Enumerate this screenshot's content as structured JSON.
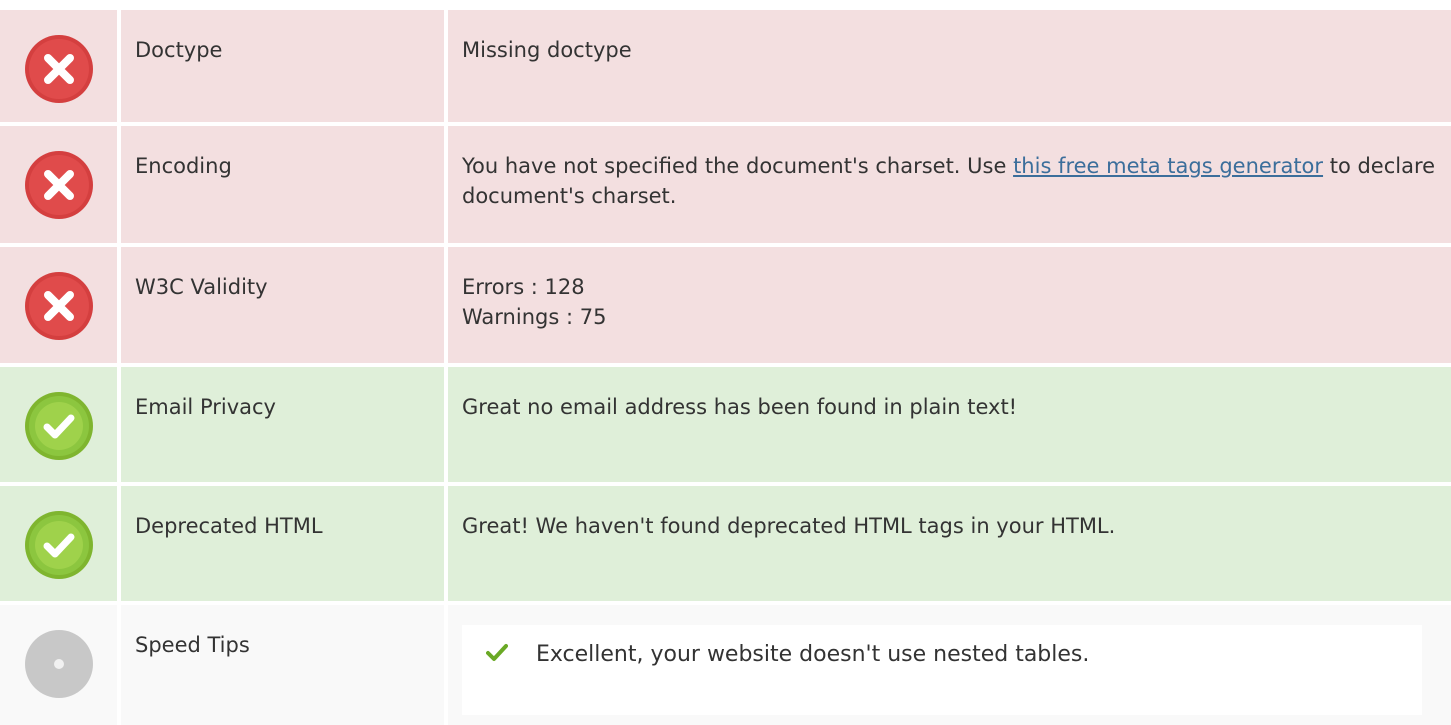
{
  "colors": {
    "error_bg": "#f3dfe0",
    "ok_bg": "#dfefd9",
    "neutral_bg": "#f9f9f9",
    "link": "#3b6e9b",
    "error_icon": "#d43f3f",
    "ok_icon": "#8cc63f"
  },
  "rows": [
    {
      "status": "error",
      "icon": "error-x-icon",
      "label": "Doctype",
      "value": "Missing doctype"
    },
    {
      "status": "error",
      "icon": "error-x-icon",
      "label": "Encoding",
      "value_before": "You have not specified the document's charset. Use ",
      "link_text": "this free meta tags generator",
      "value_after": " to declare document's charset."
    },
    {
      "status": "error",
      "icon": "error-x-icon",
      "label": "W3C Validity",
      "errors_line": "Errors : 128",
      "warnings_line": "Warnings : 75"
    },
    {
      "status": "ok",
      "icon": "check-circle-icon",
      "label": "Email Privacy",
      "value": "Great no email address has been found in plain text!"
    },
    {
      "status": "ok",
      "icon": "check-circle-icon",
      "label": "Deprecated HTML",
      "value": "Great! We haven't found deprecated HTML tags in your HTML."
    },
    {
      "status": "neutral",
      "icon": "neutral-circle-icon",
      "label": "Speed Tips",
      "tips": [
        {
          "icon": "green-check-icon",
          "text": "Excellent, your website doesn't use nested tables."
        }
      ]
    }
  ]
}
